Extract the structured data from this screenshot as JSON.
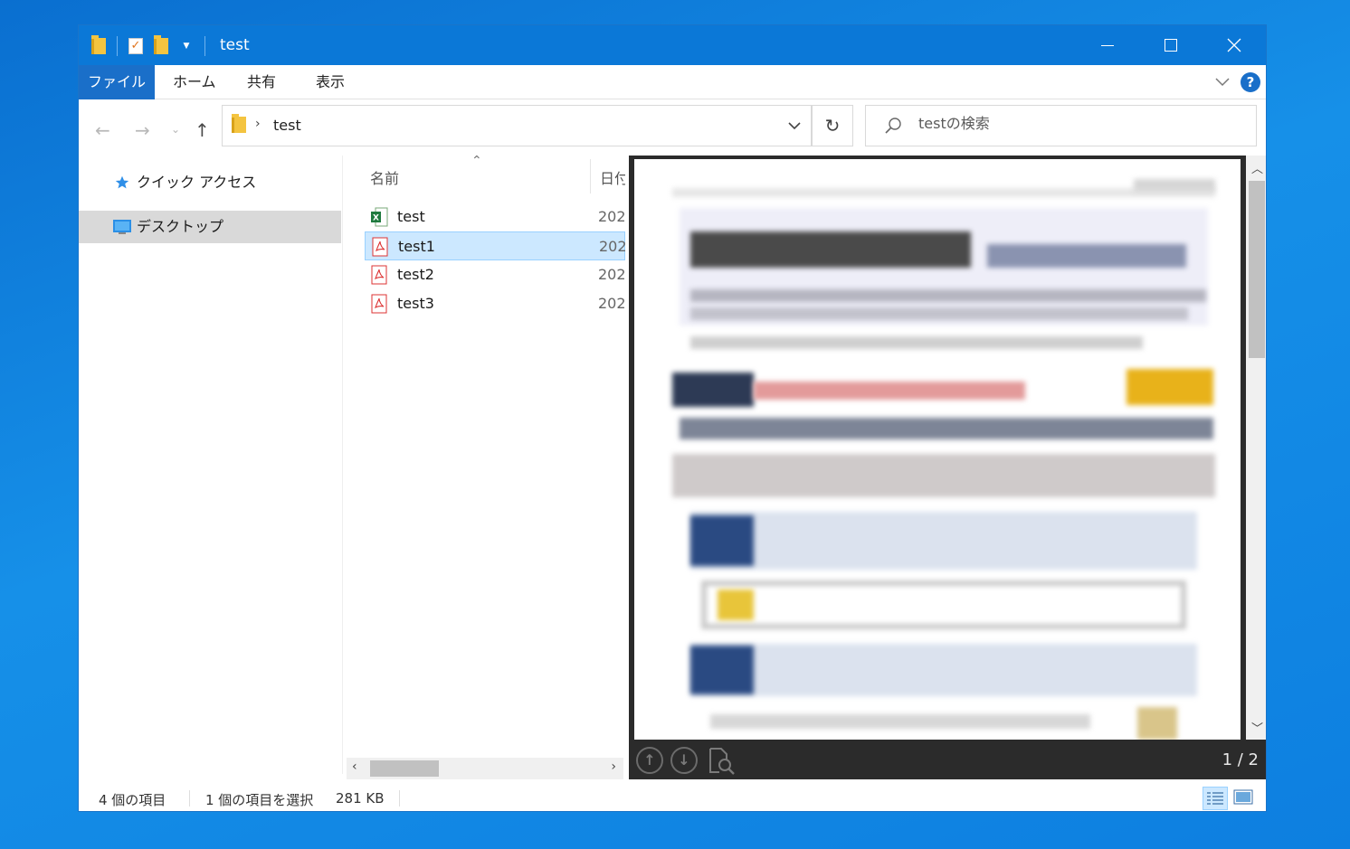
{
  "window": {
    "title": "test"
  },
  "ribbon": {
    "tabs": [
      "ファイル",
      "ホーム",
      "共有",
      "表示"
    ],
    "help": "?"
  },
  "address": {
    "breadcrumb": [
      "test"
    ],
    "search_placeholder": "testの検索"
  },
  "nav_pane": {
    "items": [
      {
        "label": "クイック アクセス",
        "icon": "star-icon",
        "selected": false
      },
      {
        "label": "デスクトップ",
        "icon": "desktop-icon",
        "selected": true
      }
    ]
  },
  "file_list": {
    "columns": [
      "名前",
      "日付"
    ],
    "rows": [
      {
        "name": "test",
        "type": "excel",
        "date": "202",
        "selected": false
      },
      {
        "name": "test1",
        "type": "pdf",
        "date": "202",
        "selected": true
      },
      {
        "name": "test2",
        "type": "pdf",
        "date": "202",
        "selected": false
      },
      {
        "name": "test3",
        "type": "pdf",
        "date": "202",
        "selected": false
      }
    ]
  },
  "preview": {
    "page_count": "1 / 2"
  },
  "status": {
    "item_count": "4 個の項目",
    "selection": "1 個の項目を選択",
    "size": "281 KB"
  },
  "colors": {
    "titlebar": "#0b78d7",
    "file_tab": "#1a6fc9",
    "selection": "#cce8ff",
    "selection_border": "#99d1ff"
  }
}
